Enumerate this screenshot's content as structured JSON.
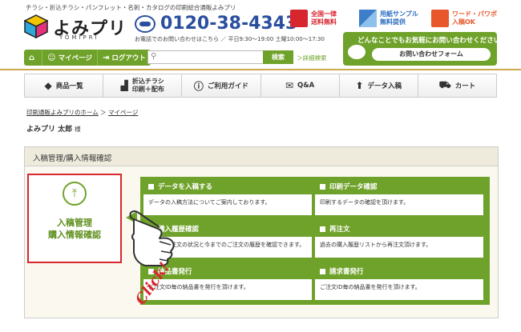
{
  "header": {
    "tagline": "チラシ・折込チラシ・パンフレット・名刺・カタログの印刷総合通販よみプリ",
    "logo": "よみプリ",
    "logo_sub": "YOMIPRI",
    "phone": "0120-38-4343",
    "hours": "お電話でのお問い合わせはこちら ／ 平日9:30〜19:00 土曜10:00〜17:30",
    "badges": [
      {
        "line1": "全国一律",
        "line2": "送料無料"
      },
      {
        "line1": "用紙サンプル",
        "line2": "無料提供"
      },
      {
        "line1": "ワード・パワポ",
        "line2": "入稿OK"
      }
    ],
    "account": {
      "mypage": "マイページ",
      "logout": "ログアウト"
    },
    "search": {
      "placeholder": "",
      "button": "検索",
      "detail": "＞詳細検索"
    },
    "contact": {
      "title": "どんなことでもお気軽にお問い合わせください",
      "button": "お問い合わせフォーム"
    }
  },
  "nav": [
    {
      "label": "商品一覧"
    },
    {
      "label1": "折込チラシ",
      "label2": "印刷＋配布"
    },
    {
      "label": "ご利用ガイド"
    },
    {
      "label": "Q&A"
    },
    {
      "label": "データ入稿"
    },
    {
      "label": "カート"
    }
  ],
  "breadcrumb": {
    "home": "印刷通販よみプリのホーム",
    "sep": " ＞ ",
    "current": "マイページ"
  },
  "user": {
    "name": "よみプリ 太郎",
    "suffix": "様"
  },
  "section": {
    "title": "入稿管理/購入情報確認",
    "tile_line1": "入稿管理",
    "tile_line2": "購入情報確認",
    "cards": [
      {
        "title": "データを入稿する",
        "body": "データの入稿方法についてご案内しております。"
      },
      {
        "title": "印刷データ確認",
        "body": "印刷するデータの確認を頂けます。"
      },
      {
        "title": "購入履歴確認",
        "body": "現在のご注文の状況と今までのご注文の履歴を確認できます。"
      },
      {
        "title": "再注文",
        "body": "過去の購入履歴リストから再注文頂けます。"
      },
      {
        "title": "納品書発行",
        "body": "ご注文ID毎の納品書を発行を頂けます。"
      },
      {
        "title": "請求書発行",
        "body": "ご注文ID毎の納品書を発行を頂けます。"
      }
    ],
    "click_text": "Click!"
  }
}
